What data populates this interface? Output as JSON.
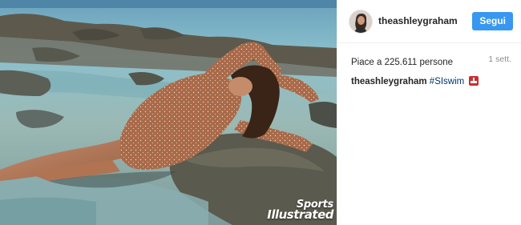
{
  "post": {
    "photo": {
      "alt_icon": "beach-photo",
      "brand_line1": "Sports",
      "brand_line2": "Illustrated"
    },
    "header": {
      "username": "theashleygraham",
      "follow_label": "Segui",
      "follow_color": "#3897f0"
    },
    "likes": {
      "prefix": "Piace a",
      "count": "225.611",
      "suffix": "persone",
      "timestamp": "1 sett."
    },
    "caption": {
      "username": "theashleygraham",
      "hashtag": "#SIswim",
      "trailing_icon": "flag-emoji-icon"
    }
  }
}
